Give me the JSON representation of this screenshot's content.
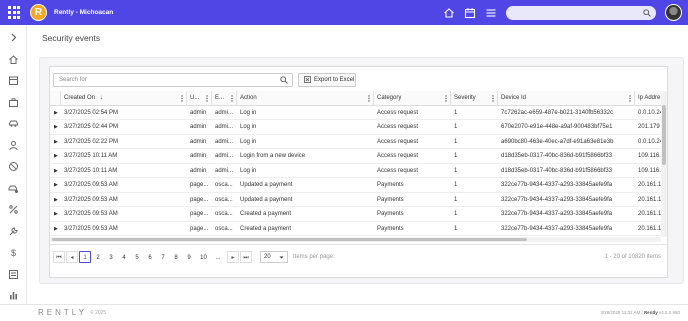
{
  "app": {
    "title": "Rently - Michoacan",
    "logo_letter": "R"
  },
  "page": {
    "title": "Security events"
  },
  "toolbar": {
    "search_placeholder": "Search for",
    "export_label": "Export to Excel"
  },
  "table": {
    "headers": [
      "Created On",
      "U...",
      "E...",
      "Action",
      "Category",
      "Severity",
      "Device Id",
      "Ip Addre"
    ],
    "rows": [
      [
        "3/27/2025 02:54 PM",
        "admin",
        "admi...",
        "Log in",
        "Access request",
        "1",
        "7c7262ac-e659-487e-b021-3140fb56332c",
        "0.0.10.24"
      ],
      [
        "3/27/2025 02:44 PM",
        "admin",
        "admi...",
        "Log in",
        "Access request",
        "1",
        "670e2070-e91e-448e-a9af-900483bf75e1",
        "201.179"
      ],
      [
        "3/27/2025 02:22 PM",
        "admin",
        "admi...",
        "Log in",
        "Access request",
        "1",
        "a690bc80-463e-40ec-a7df-e91a63e81e3b",
        "0.0.10.24"
      ],
      [
        "3/27/2025 10:11 AM",
        "admin",
        "admi...",
        "Login from a new device",
        "Access request",
        "1",
        "d18d35eb-0317-40bc-836d-b91f5866bf33",
        "109.116."
      ],
      [
        "3/27/2025 10:11 AM",
        "admin",
        "admi...",
        "Log in",
        "Access request",
        "1",
        "d18d35eb-0317-40bc-836d-b91f5866bf33",
        "109.116."
      ],
      [
        "3/27/2025 09:53 AM",
        "page...",
        "osca...",
        "Updated a payment",
        "Payments",
        "1",
        "322ce77b-9434-4337-a293-33845aefe9fa",
        "20.161.1"
      ],
      [
        "3/27/2025 09:53 AM",
        "page...",
        "osca...",
        "Updated a payment",
        "Payments",
        "1",
        "322ce77b-9434-4337-a293-33845aefe9fa",
        "20.161.1"
      ],
      [
        "3/27/2025 09:53 AM",
        "page...",
        "osca...",
        "Created a payment",
        "Payments",
        "1",
        "322ce77b-9434-4337-a293-33845aefe9fa",
        "20.161.1"
      ],
      [
        "3/27/2025 09:53 AM",
        "page...",
        "osca...",
        "Created a payment",
        "Payments",
        "1",
        "322ce77b-9434-4337-a293-33845aefe9fa",
        "20.161.1"
      ]
    ]
  },
  "pager": {
    "pages": [
      "1",
      "2",
      "3",
      "4",
      "5",
      "6",
      "7",
      "8",
      "9",
      "10",
      "..."
    ],
    "active_page": "1",
    "page_size": "20",
    "items_label": "Items per page:",
    "count_label": "1 - 20 of 10820 items"
  },
  "footer": {
    "logo": "RENTLY",
    "copyright": "© 2025",
    "timestamp": "3/28/2025 11:31 AM",
    "brand": "Rently",
    "version": "v4.2.0.980"
  },
  "colors": {
    "topbar": "#4f46e5",
    "logo": "#f5a623"
  }
}
